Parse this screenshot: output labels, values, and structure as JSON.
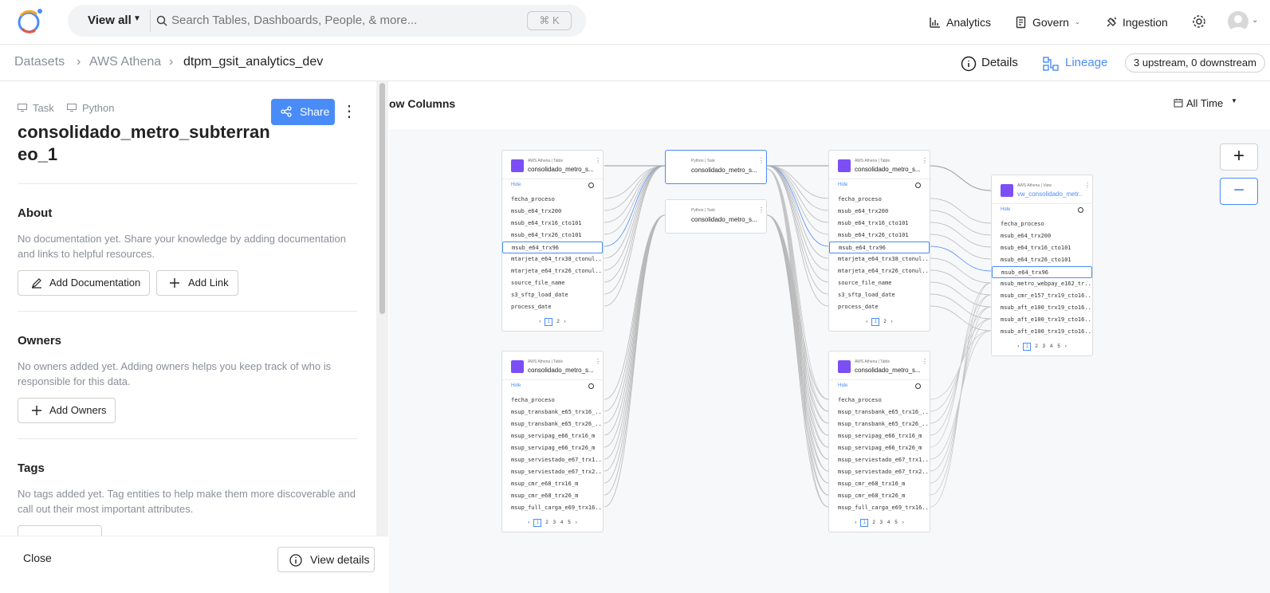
{
  "topbar": {
    "view_all": "View all",
    "search_placeholder": "Search Tables, Dashboards, People, & more...",
    "shortcut": "⌘ K",
    "nav": {
      "analytics": "Analytics",
      "govern": "Govern",
      "ingestion": "Ingestion"
    }
  },
  "breadcrumb": {
    "datasets": "Datasets",
    "platform": "AWS Athena",
    "current": "dtpm_gsit_analytics_dev"
  },
  "tabs": {
    "details": "Details",
    "lineage": "Lineage",
    "stream_badge": "3 upstream, 0 downstream"
  },
  "panel": {
    "type_task": "Task",
    "type_platform": "Python",
    "share": "Share",
    "title": "consolidado_metro_subterraneo_1",
    "about": {
      "title": "About",
      "desc": "No documentation yet. Share your knowledge by adding documentation and links to helpful resources.",
      "add_doc": "Add Documentation",
      "add_link": "Add Link"
    },
    "owners": {
      "title": "Owners",
      "desc": "No owners added yet. Adding owners helps you keep track of who is responsible for this data.",
      "add_owners": "Add Owners"
    },
    "tags": {
      "title": "Tags",
      "desc": "No tags added yet. Tag entities to help make them more discoverable and call out their most important attributes."
    },
    "close": "Close",
    "view_details": "View details"
  },
  "lineage": {
    "show_columns": "ow Columns",
    "all_time": "All Time",
    "hide": "Hide",
    "nodes": {
      "t1": {
        "sub": "AWS Athena  |  Table",
        "name": "consolidado_metro_s...",
        "cols": [
          "fecha_proceso",
          "msub_e64_trx200",
          "msub_e64_trx16_cto101",
          "msub_e64_trx26_cto101",
          "msub_e64_trx96",
          "mtarjeta_e64_trx38_ctonul...",
          "mtarjeta_e64_trx26_ctonul...",
          "source_file_name",
          "s3_sftp_load_date",
          "process_date"
        ],
        "pages": [
          "1",
          "2"
        ]
      },
      "t2": {
        "sub": "AWS Athena  |  Table",
        "name": "consolidado_metro_s...",
        "cols": [
          "fecha_proceso",
          "msup_transbank_e65_trx16_...",
          "msup_transbank_e65_trx26_...",
          "msup_servipag_e66_trx16_m",
          "msup_servipag_e66_trx26_m",
          "msup_serviestado_e67_trx1...",
          "msup_serviestado_e67_trx2...",
          "msup_cmr_e68_trx16_m",
          "msup_cmr_e68_trx26_m",
          "msup_full_carga_e69_trx16..."
        ],
        "pages": [
          "1",
          "2",
          "3",
          "4",
          "5"
        ]
      },
      "task1": {
        "sub": "Python  |  Task",
        "name": "consolidado_metro_s..."
      },
      "task2": {
        "sub": "Python  |  Task",
        "name": "consolidado_metro_s..."
      },
      "t3": {
        "sub": "AWS Athena  |  Table",
        "name": "consolidado_metro_s...",
        "cols": [
          "fecha_proceso",
          "msub_e64_trx200",
          "msub_e64_trx16_cto101",
          "msub_e64_trx26_cto101",
          "msub_e64_trx96",
          "mtarjeta_e64_trx38_ctonul...",
          "mtarjeta_e64_trx26_ctonul...",
          "source_file_name",
          "s3_sftp_load_date",
          "process_date"
        ],
        "pages": [
          "1",
          "2"
        ]
      },
      "t4": {
        "sub": "AWS Athena  |  Table",
        "name": "consolidado_metro_s...",
        "cols": [
          "fecha_proceso",
          "msup_transbank_e65_trx16_...",
          "msup_transbank_e65_trx26_...",
          "msup_servipag_e66_trx16_m",
          "msup_servipag_e66_trx26_m",
          "msup_serviestado_e67_trx1...",
          "msup_serviestado_e67_trx2...",
          "msup_cmr_e68_trx16_m",
          "msup_cmr_e68_trx26_m",
          "msup_full_carga_e69_trx16..."
        ],
        "pages": [
          "1",
          "2",
          "3",
          "4",
          "5"
        ]
      },
      "v1": {
        "sub": "AWS Athena  |  View",
        "name": "vw_consolidado_metr...",
        "cols": [
          "fecha_proceso",
          "msub_e64_trx200",
          "msub_e64_trx16_cto101",
          "msub_e64_trx26_cto101",
          "msub_e64_trx96",
          "msub_metro_webpay_e162_tr...",
          "msub_cmr_e157_trx19_cto16...",
          "msub_aft_e100_trx19_cto16...",
          "msub_aft_e100_trx19_cto16...",
          "msub_aft_e100_trx19_cto16..."
        ],
        "pages": [
          "1",
          "2",
          "3",
          "4",
          "5"
        ]
      }
    }
  }
}
